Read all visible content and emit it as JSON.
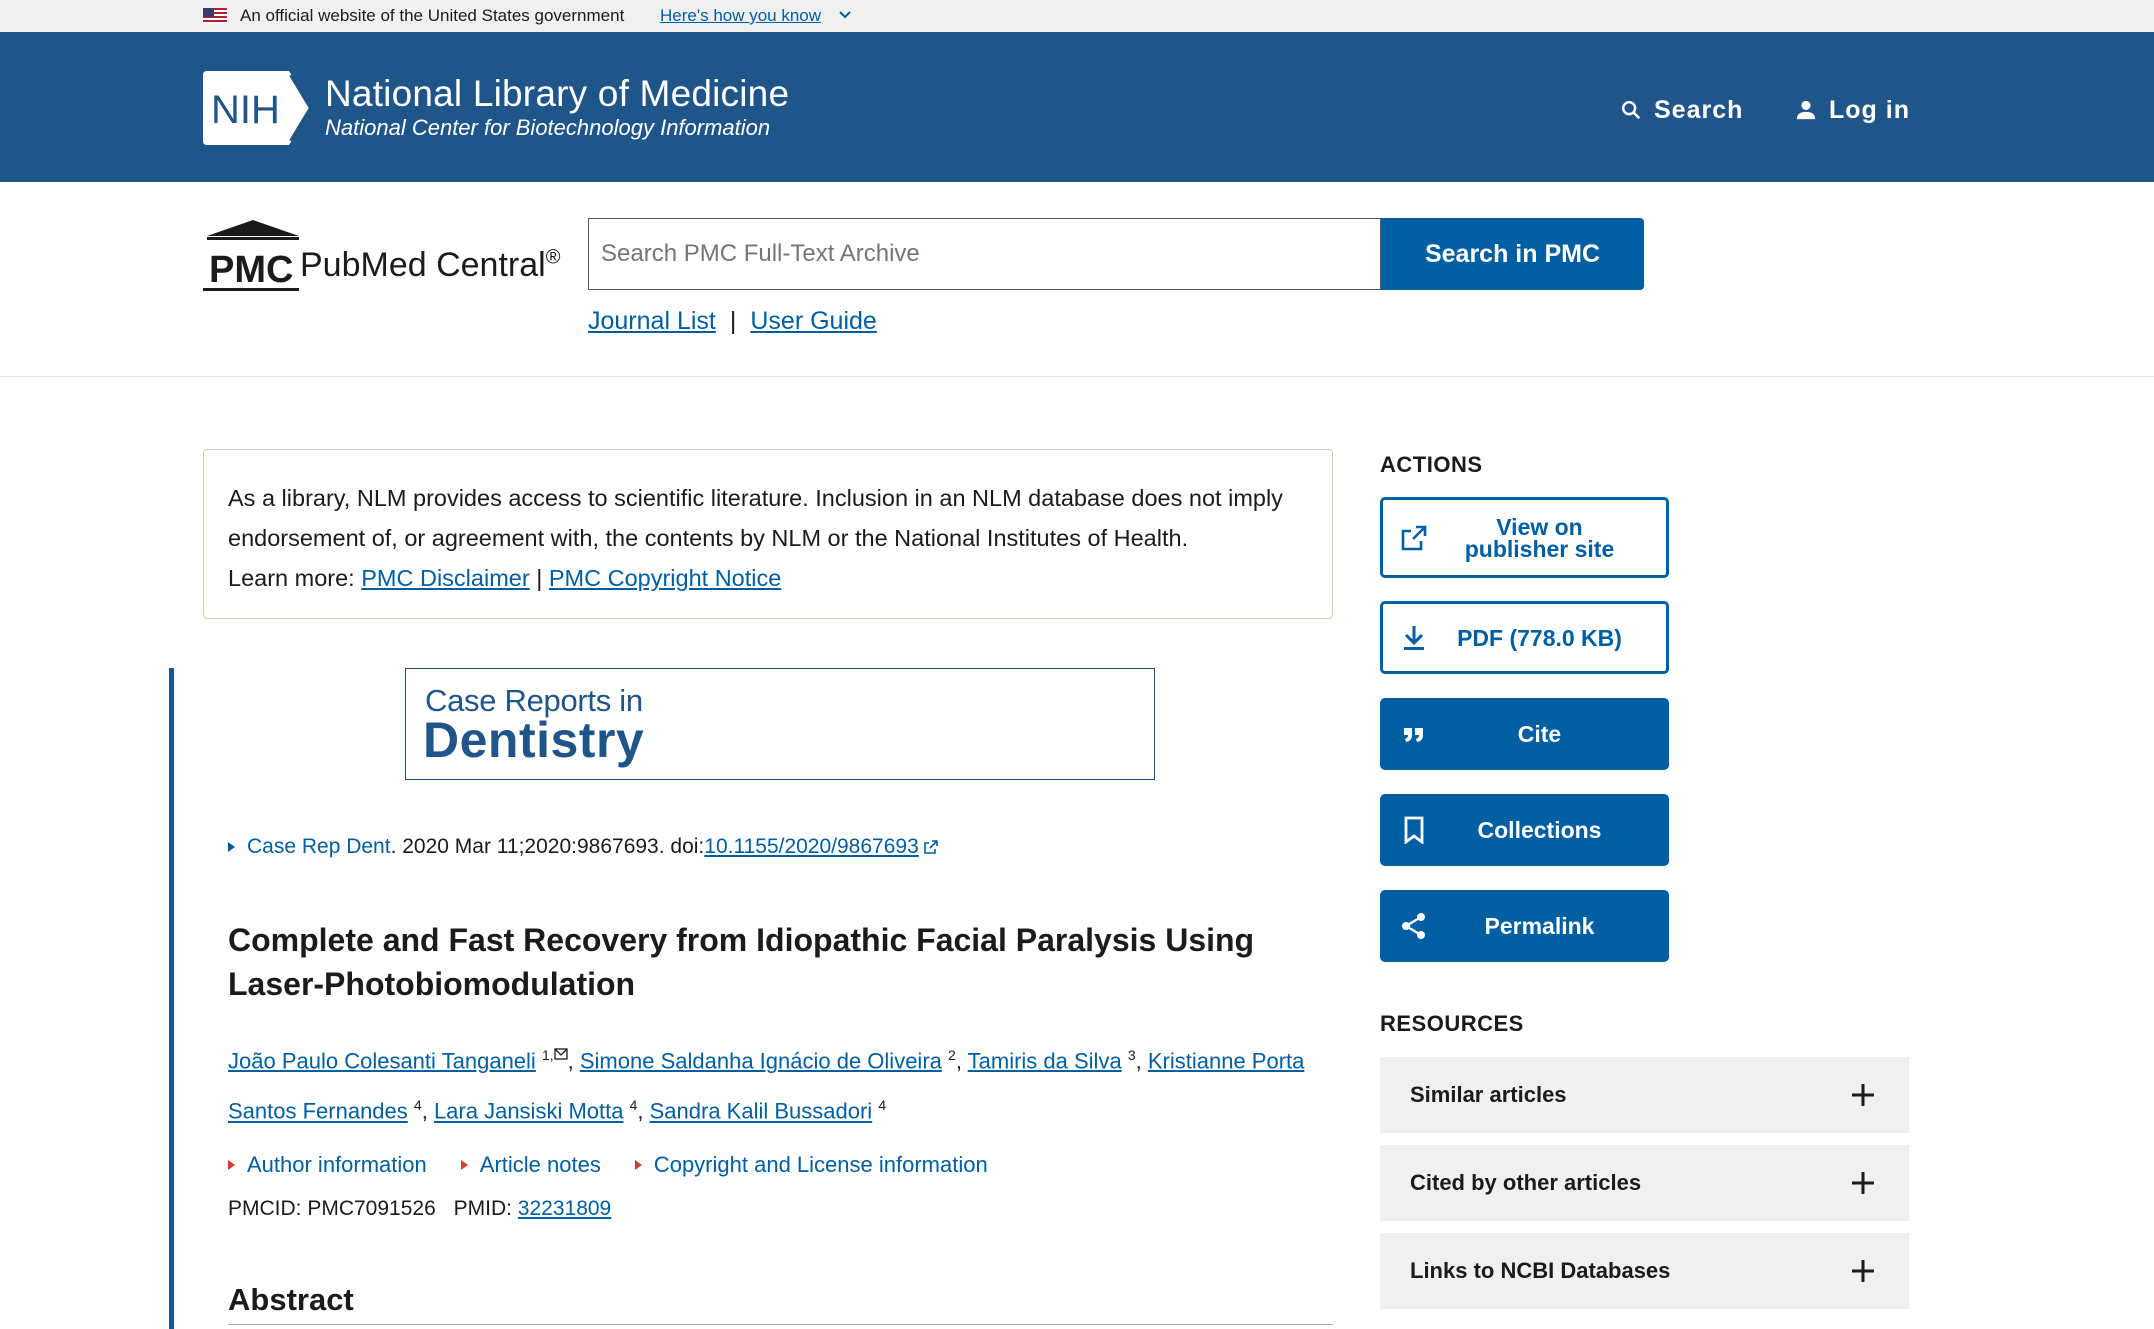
{
  "gov_banner": {
    "text": "An official website of the United States government",
    "link": "Here's how you know"
  },
  "header": {
    "logo_text": "NIH",
    "title": "National Library of Medicine",
    "subtitle": "National Center for Biotechnology Information",
    "search_label": "Search",
    "login_label": "Log in"
  },
  "pmc": {
    "logo_text": "PMC",
    "name": "PubMed Central",
    "registered": "®",
    "search_placeholder": "Search PMC Full-Text Archive",
    "search_button": "Search in PMC",
    "journal_list": "Journal List",
    "separator": "|",
    "user_guide": "User Guide"
  },
  "disclaimer": {
    "text": "As a library, NLM provides access to scientific literature. Inclusion in an NLM database does not imply endorsement of, or agreement with, the contents by NLM or the National Institutes of Health.",
    "learn_more": "Learn more:",
    "link1": "PMC Disclaimer",
    "separator": "|",
    "link2": "PMC Copyright Notice"
  },
  "journal_banner": {
    "line1": "Case Reports in",
    "line2": "Dentistry"
  },
  "citation": {
    "journal": "Case Rep Dent",
    "details": ". 2020 Mar 11;2020:9867693. doi: ",
    "doi": "10.1155/2020/9867693"
  },
  "article": {
    "title": "Complete and Fast Recovery from Idiopathic Facial Paralysis Using Laser-Photobiomodulation",
    "authors": [
      {
        "name": "João Paulo Colesanti Tanganeli",
        "sup": "1,"
      },
      {
        "name": "Simone Saldanha Ignácio de Oliveira",
        "sup": "2"
      },
      {
        "name": "Tamiris da Silva",
        "sup": "3"
      },
      {
        "name": "Kristianne Porta Santos Fernandes",
        "sup": "4"
      },
      {
        "name": "Lara Jansiski Motta",
        "sup": "4"
      },
      {
        "name": "Sandra Kalil Bussadori",
        "sup": "4"
      }
    ],
    "author_sep": ", ",
    "author_info": "Author information",
    "article_notes": "Article notes",
    "copyright_info": "Copyright and License information",
    "pmcid_label": "PMCID: PMC7091526",
    "pmid_label": "PMID:",
    "pmid": "32231809",
    "abstract_heading": "Abstract"
  },
  "sidebar": {
    "actions_heading": "ACTIONS",
    "view_publisher_line1": "View on",
    "view_publisher_line2": "publisher site",
    "pdf": "PDF (778.0 KB)",
    "cite": "Cite",
    "collections": "Collections",
    "permalink": "Permalink",
    "resources_heading": "RESOURCES",
    "resources": [
      "Similar articles",
      "Cited by other articles",
      "Links to NCBI Databases"
    ]
  },
  "colors": {
    "header_blue": "#20558a",
    "link_blue": "#005ea2",
    "accent_red": "#d83933"
  }
}
